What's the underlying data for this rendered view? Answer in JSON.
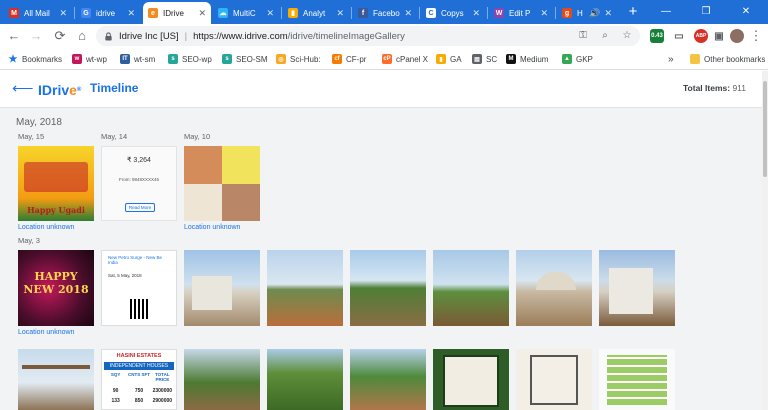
{
  "browser": {
    "tabs": [
      {
        "label": "All Mail",
        "favicon": "gmail-icon",
        "color": "#d93025",
        "glyph": "M"
      },
      {
        "label": "idrive",
        "favicon": "google-icon",
        "color": "#4285f4",
        "glyph": "G"
      },
      {
        "label": "IDrive",
        "favicon": "idrive-icon",
        "color": "#f28b20",
        "glyph": "e"
      },
      {
        "label": "MultiC",
        "favicon": "multicloud-icon",
        "color": "#29b6f6",
        "glyph": "☁"
      },
      {
        "label": "Analyt",
        "favicon": "analytics-icon",
        "color": "#f9ab00",
        "glyph": "▮"
      },
      {
        "label": "Facebo",
        "favicon": "facebook-icon",
        "color": "#3b5998",
        "glyph": "f"
      },
      {
        "label": "Copys",
        "favicon": "copyscape-icon",
        "color": "#ffffff",
        "glyph": "C"
      },
      {
        "label": "Edit P",
        "favicon": "edit-post-icon",
        "color": "#8e44ad",
        "glyph": "W"
      },
      {
        "label": "H",
        "favicon": "g-icon",
        "color": "#e64a19",
        "glyph": "g"
      }
    ],
    "active_tab_index": 2,
    "sound_indicator": "🔊",
    "new_tab_glyph": "+",
    "window_controls": {
      "minimize": "—",
      "restore": "❐",
      "close": "✕"
    },
    "url_site": "Idrive Inc [US]",
    "url_host": "https://www.idrive.com",
    "url_path": "/idrive/timelineImageGallery",
    "nav": {
      "back": "←",
      "forward": "→",
      "reload": "⟳",
      "home": "⌂"
    },
    "extensions": [
      {
        "name": "extension-timer",
        "label": "0.43",
        "color": "#188038"
      },
      {
        "name": "extension-card",
        "label": "▭",
        "color": "#5f6368"
      },
      {
        "name": "extension-abp",
        "label": "ABP",
        "color": "#d93025"
      },
      {
        "name": "extension-box",
        "label": "▣",
        "color": "#5f6368"
      }
    ],
    "bookmarks": [
      {
        "label": "Bookmarks",
        "icon": "star-icon",
        "color": "#1a73e8",
        "glyph": "★"
      },
      {
        "label": "wt-wp",
        "icon": "site-icon",
        "color": "#c2185b",
        "glyph": "w"
      },
      {
        "label": "wt-sm",
        "icon": "site-icon",
        "color": "#2f5e9e",
        "glyph": "IT"
      },
      {
        "label": "SEO-wp",
        "icon": "site-icon",
        "color": "#26a69a",
        "glyph": "s"
      },
      {
        "label": "SEO-SM",
        "icon": "site-icon",
        "color": "#26a69a",
        "glyph": "s"
      },
      {
        "label": "Sci-Hub:",
        "icon": "site-icon",
        "color": "#f9a825",
        "glyph": "◎"
      },
      {
        "label": "CF-pr",
        "icon": "site-icon",
        "color": "#f57c00",
        "glyph": "cf"
      },
      {
        "label": "cPanel X",
        "icon": "site-icon",
        "color": "#ff6c2c",
        "glyph": "cP"
      },
      {
        "label": "GA",
        "icon": "site-icon",
        "color": "#f9ab00",
        "glyph": "▮"
      },
      {
        "label": "SC",
        "icon": "site-icon",
        "color": "#5f6368",
        "glyph": "▤"
      },
      {
        "label": "Medium",
        "icon": "site-icon",
        "color": "#111111",
        "glyph": "M"
      },
      {
        "label": "GKP",
        "icon": "site-icon",
        "color": "#34a853",
        "glyph": "▲"
      }
    ],
    "more_bookmarks": "»",
    "other_bookmarks": "Other bookmarks"
  },
  "app": {
    "back_glyph": "⟵",
    "logo_prefix": "IDriv",
    "logo_e": "e",
    "logo_mark": "®",
    "title": "Timeline",
    "total_label": "Total Items:",
    "total_value": "911",
    "month": "May, 2018",
    "groups": [
      {
        "date": "May, 15",
        "location": "Location unknown"
      },
      {
        "date": "May, 14",
        "location": ""
      },
      {
        "date": "May, 10",
        "location": "Location unknown"
      },
      {
        "date": "May, 3",
        "location": "Location unknown"
      }
    ],
    "thumb_text": {
      "ugadi": "Happy Ugadi",
      "phone_amount": "₹ 3,264",
      "phone_from": "From: 9848XXXX45",
      "phone_btn": "Read More",
      "newyear": "HAPPY NEW 2018",
      "app_title": "New Petro Surge - New Be India",
      "app_date": "Sat, 5 May, 2018",
      "brochure_title": "HASINI ESTATES",
      "brochure_sub": "INDEPENDENT HOUSES",
      "brochure_headers": [
        "SQY",
        "CNTS SFT",
        "TOTAL PRICE"
      ],
      "brochure_rows": [
        [
          "90",
          "750",
          "2300000"
        ],
        [
          "133",
          "850",
          "2900000"
        ]
      ]
    }
  }
}
